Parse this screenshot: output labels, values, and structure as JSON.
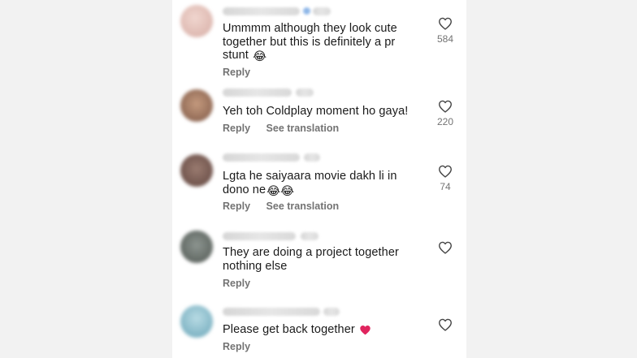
{
  "comments": [
    {
      "text": "Ummmm although they look cute together but this is definitely a pr stunt",
      "emoji": "😂",
      "actions": [
        "Reply"
      ],
      "likes": "584",
      "avatar_color": "#e7c9c3"
    },
    {
      "text": "Yeh toh Coldplay moment ho gaya!",
      "emoji": "",
      "actions": [
        "Reply",
        "See translation"
      ],
      "likes": "220",
      "avatar_color": "#a07a63"
    },
    {
      "text": "Lgta he saiyaara movie dakh li in dono ne",
      "emoji": "😂😂",
      "actions": [
        "Reply",
        "See translation"
      ],
      "likes": "74",
      "avatar_color": "#7a5b52"
    },
    {
      "text": "They are doing a project together nothing else",
      "emoji": "",
      "actions": [
        "Reply"
      ],
      "likes": "",
      "avatar_color": "#6a716c"
    },
    {
      "text": "Please get back together",
      "emoji": "❤️",
      "actions": [
        "Reply"
      ],
      "likes": "",
      "avatar_color": "#89bfcf"
    }
  ],
  "icons": {
    "like": "heart-outline-icon"
  },
  "colors": {
    "text": "#1a1a1a",
    "secondary": "#737373",
    "heart_red": "#e0245e"
  }
}
